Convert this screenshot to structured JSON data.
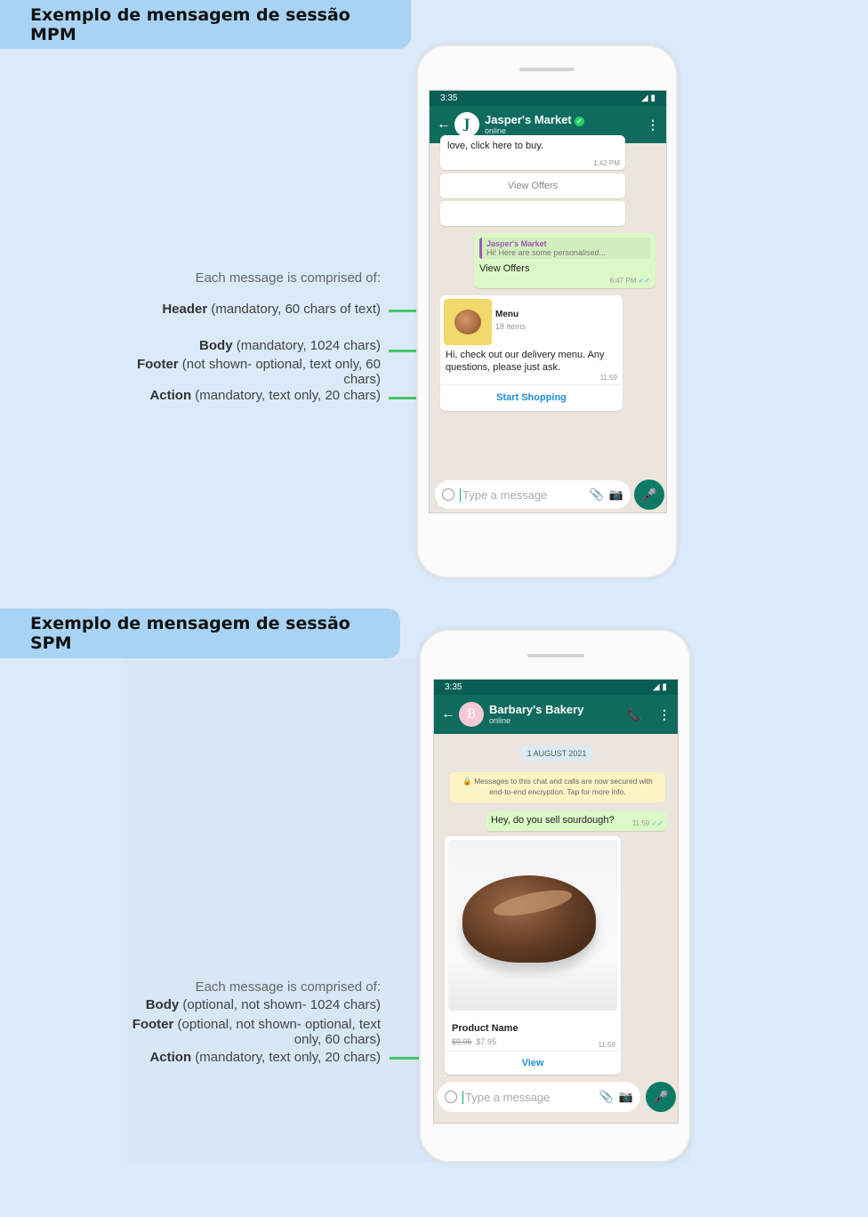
{
  "mpm": {
    "title": "Exemplo de mensagem de sessão MPM",
    "annotations": {
      "intro": "Each message is comprised of:",
      "header_label": "Header",
      "header_desc": " (mandatory, 60 chars of text)",
      "body_label": "Body",
      "body_desc": " (mandatory, 1024 chars)",
      "footer_label": "Footer",
      "footer_desc": " (not shown- optional, text only, 60 chars)",
      "action_label": "Action",
      "action_desc": " (mandatory, text only, 20 chars)"
    },
    "phone": {
      "time": "3:35",
      "contact_name": "Jasper's Market",
      "contact_status": "online",
      "avatar_letter": "J",
      "prev_text": "love, click here to buy.",
      "prev_time": "1:42 PM",
      "btn1": "View Offers",
      "btn2": "",
      "reply_quote_name": "Jasper's Market",
      "reply_quote_text": "Hi! Here are some personalised...",
      "reply_text": "View Offers",
      "reply_time": "6:47 PM",
      "card_header": "Menu",
      "card_count": "18 items",
      "card_body": "Hi, check out our delivery menu. Any questions, please just ask.",
      "card_time": "11:59",
      "card_action": "Start Shopping",
      "input_placeholder": "Type a message"
    }
  },
  "spm": {
    "title": "Exemplo de mensagem de sessão SPM",
    "annotations": {
      "intro": "Each message is comprised of:",
      "body_label": "Body",
      "body_desc": " (optional, not shown- 1024 chars)",
      "footer_label": "Footer",
      "footer_desc": " (optional, not shown- optional, text only, 60 chars)",
      "action_label": "Action",
      "action_desc": " (mandatory, text only, 20 chars)"
    },
    "phone": {
      "time": "3:35",
      "contact_name": "Barbary's Bakery",
      "contact_status": "online",
      "avatar_letter": "B",
      "date_chip": "1 AUGUST 2021",
      "security_notice": "Messages to this chat and calls are now secured with end-to-end encryption. Tap for more info.",
      "sent_text": "Hey, do you sell sourdough?",
      "sent_time": "11:59",
      "product_name": "Product Name",
      "old_price": "$9.95",
      "new_price": "$7.95",
      "product_time": "11:59",
      "product_action": "View",
      "input_placeholder": "Type a message"
    }
  },
  "colors": {
    "accent_green": "#4bc36b",
    "header_blue": "#a9d3f3",
    "wa_teal": "#075e54"
  }
}
